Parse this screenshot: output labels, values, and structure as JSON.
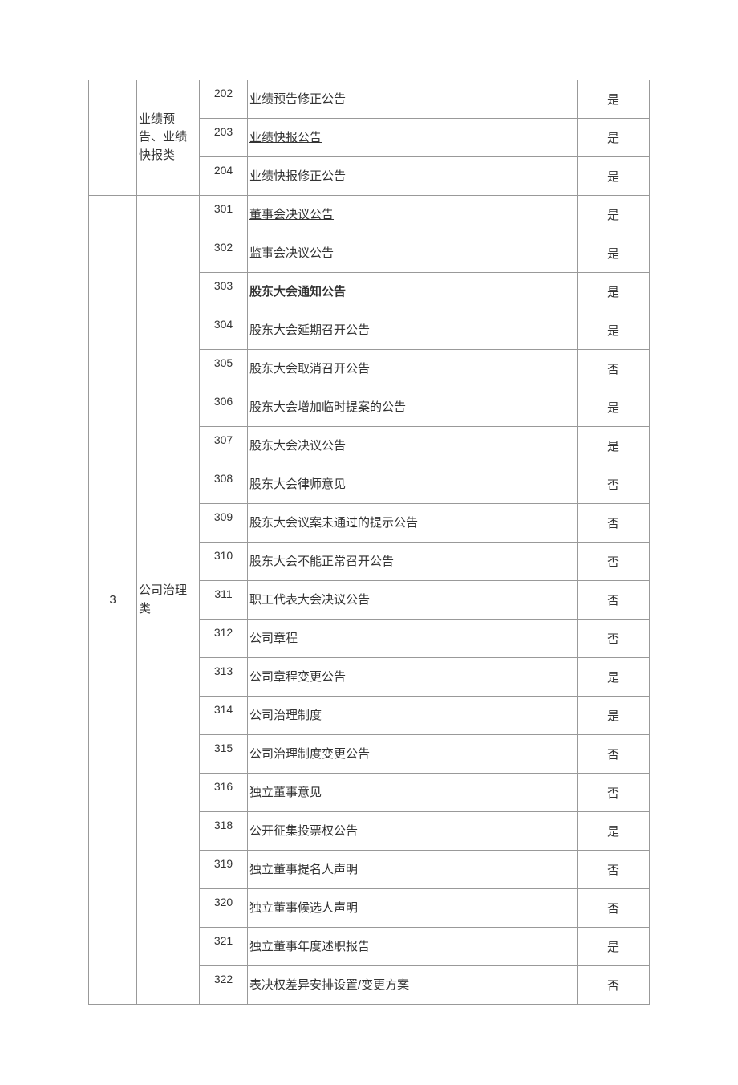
{
  "groups": [
    {
      "index": "",
      "category": "业绩预告、业绩快报类",
      "rows": [
        {
          "code": "202",
          "name": "业绩预告修正公告",
          "yesno": "是",
          "underline": true,
          "bold": false
        },
        {
          "code": "203",
          "name": "业绩快报公告",
          "yesno": "是",
          "underline": true,
          "bold": false
        },
        {
          "code": "204",
          "name": "业绩快报修正公告",
          "yesno": "是",
          "underline": false,
          "bold": false
        }
      ]
    },
    {
      "index": "3",
      "category": "公司治理类",
      "rows": [
        {
          "code": "301",
          "name": "董事会决议公告",
          "yesno": "是",
          "underline": true,
          "bold": false
        },
        {
          "code": "302",
          "name": "监事会决议公告",
          "yesno": "是",
          "underline": true,
          "bold": false
        },
        {
          "code": "303",
          "name": "股东大会通知公告",
          "yesno": "是",
          "underline": false,
          "bold": true
        },
        {
          "code": "304",
          "name": "股东大会延期召开公告",
          "yesno": "是",
          "underline": false,
          "bold": false
        },
        {
          "code": "305",
          "name": "股东大会取消召开公告",
          "yesno": "否",
          "underline": false,
          "bold": false
        },
        {
          "code": "306",
          "name": "股东大会增加临时提案的公告",
          "yesno": "是",
          "underline": false,
          "bold": false
        },
        {
          "code": "307",
          "name": "股东大会决议公告",
          "yesno": "是",
          "underline": false,
          "bold": false
        },
        {
          "code": "308",
          "name": "股东大会律师意见",
          "yesno": "否",
          "underline": false,
          "bold": false
        },
        {
          "code": "309",
          "name": "股东大会议案未通过的提示公告",
          "yesno": "否",
          "underline": false,
          "bold": false
        },
        {
          "code": "310",
          "name": "股东大会不能正常召开公告",
          "yesno": "否",
          "underline": false,
          "bold": false
        },
        {
          "code": "311",
          "name": "职工代表大会决议公告",
          "yesno": "否",
          "underline": false,
          "bold": false
        },
        {
          "code": "312",
          "name": "公司章程",
          "yesno": "否",
          "underline": false,
          "bold": false
        },
        {
          "code": "313",
          "name": "公司章程变更公告",
          "yesno": "是",
          "underline": false,
          "bold": false
        },
        {
          "code": "314",
          "name": "公司治理制度",
          "yesno": "是",
          "underline": false,
          "bold": false
        },
        {
          "code": "315",
          "name": "公司治理制度变更公告",
          "yesno": "否",
          "underline": false,
          "bold": false
        },
        {
          "code": "316",
          "name": "独立董事意见",
          "yesno": "否",
          "underline": false,
          "bold": false
        },
        {
          "code": "318",
          "name": "公开征集投票权公告",
          "yesno": "是",
          "underline": false,
          "bold": false
        },
        {
          "code": "319",
          "name": "独立董事提名人声明",
          "yesno": "否",
          "underline": false,
          "bold": false
        },
        {
          "code": "320",
          "name": "独立董事候选人声明",
          "yesno": "否",
          "underline": false,
          "bold": false
        },
        {
          "code": "321",
          "name": "独立董事年度述职报告",
          "yesno": "是",
          "underline": false,
          "bold": false
        },
        {
          "code": "322",
          "name": "表决权差异安排设置/变更方案",
          "yesno": "否",
          "underline": false,
          "bold": false
        }
      ]
    }
  ]
}
